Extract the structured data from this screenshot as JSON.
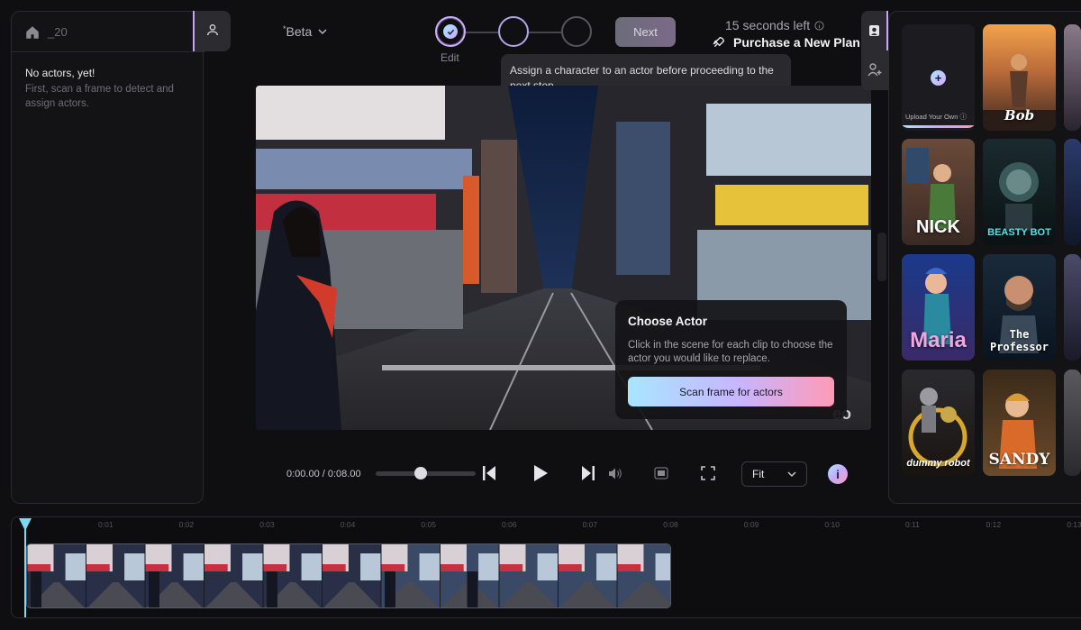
{
  "left_panel": {
    "counter": "_20",
    "empty_title": "No actors, yet!",
    "empty_hint": "First, scan a frame to detect and assign actors."
  },
  "header": {
    "model_selector": "Beta",
    "model_prefix": "*",
    "steps": [
      {
        "label": "Edit",
        "state": "done"
      },
      {
        "label": "",
        "state": "current"
      },
      {
        "label": "",
        "state": "upcoming"
      }
    ],
    "next_label": "Next",
    "seconds_left": "15 seconds left",
    "purchase_label": "Purchase a New Plan"
  },
  "tooltip": {
    "text": "Assign a character to an actor before proceeding to the next step."
  },
  "video": {
    "watermark": "eo",
    "choose_card": {
      "title": "Choose Actor",
      "description": "Click in the scene for each clip to choose the actor you would like to replace.",
      "scan_label": "Scan frame for actors"
    }
  },
  "controls": {
    "time": "0:00.00 / 0:08.00",
    "scrub_fraction": 0.45,
    "fit_value": "Fit",
    "info_label": "i"
  },
  "actors": {
    "upload_label": "Upload Your Own",
    "cards": [
      {
        "name": "Bob"
      },
      {
        "name": "NICK"
      },
      {
        "name": "BEASTY BOT"
      },
      {
        "name": "Maria"
      },
      {
        "name": "The Professor"
      },
      {
        "name": "dummy robot"
      },
      {
        "name": "SANDY"
      }
    ]
  },
  "timeline": {
    "ticks": [
      "0:01",
      "0:02",
      "0:03",
      "0:04",
      "0:05",
      "0:06",
      "0:07",
      "0:08",
      "0:09",
      "0:10",
      "0:11",
      "0:12",
      "0:13"
    ]
  },
  "colors": {
    "accent_gradient": [
      "#a8e6ff",
      "#c6a9ff",
      "#ff9ab6"
    ],
    "background": "#0f0f11",
    "panel": "#131316"
  }
}
